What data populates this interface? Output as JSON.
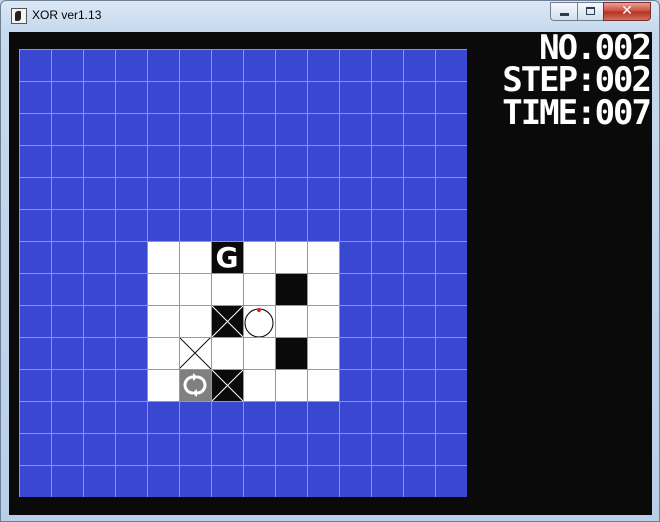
{
  "window": {
    "title": "XOR ver1.13"
  },
  "hud": {
    "level": "NO.002",
    "step": "STEP:002",
    "time": "TIME:007"
  },
  "game": {
    "board_cols": 14,
    "board_rows": 14,
    "colors": {
      "wall": "#3a48d1",
      "grid_line": "#8a93e0",
      "floor": "#ffffff",
      "block": "#0a0a0a",
      "switcher": "#808080",
      "player_marker": "#e02020"
    },
    "floor_cells": [
      [
        4,
        6
      ],
      [
        5,
        6
      ],
      [
        6,
        6
      ],
      [
        7,
        6
      ],
      [
        8,
        6
      ],
      [
        9,
        6
      ],
      [
        4,
        7
      ],
      [
        5,
        7
      ],
      [
        6,
        7
      ],
      [
        7,
        7
      ],
      [
        8,
        7
      ],
      [
        9,
        7
      ],
      [
        4,
        8
      ],
      [
        5,
        8
      ],
      [
        6,
        8
      ],
      [
        7,
        8
      ],
      [
        8,
        8
      ],
      [
        9,
        8
      ],
      [
        4,
        9
      ],
      [
        5,
        9
      ],
      [
        6,
        9
      ],
      [
        7,
        9
      ],
      [
        8,
        9
      ],
      [
        9,
        9
      ],
      [
        4,
        10
      ],
      [
        5,
        10
      ],
      [
        6,
        10
      ],
      [
        7,
        10
      ],
      [
        8,
        10
      ],
      [
        9,
        10
      ]
    ],
    "goal": {
      "cell": [
        6,
        6
      ],
      "letter": "G"
    },
    "black_blocks": [
      [
        8,
        7
      ],
      [
        8,
        9
      ]
    ],
    "crossed_blocks_dark": [
      [
        6,
        8
      ],
      [
        6,
        10
      ]
    ],
    "crossed_tiles_light": [
      [
        5,
        9
      ]
    ],
    "switcher": {
      "cell": [
        5,
        10
      ],
      "icon": "rotate-arrows-icon"
    },
    "player": {
      "cell": [
        7,
        8
      ],
      "icon": "ball-icon"
    }
  }
}
